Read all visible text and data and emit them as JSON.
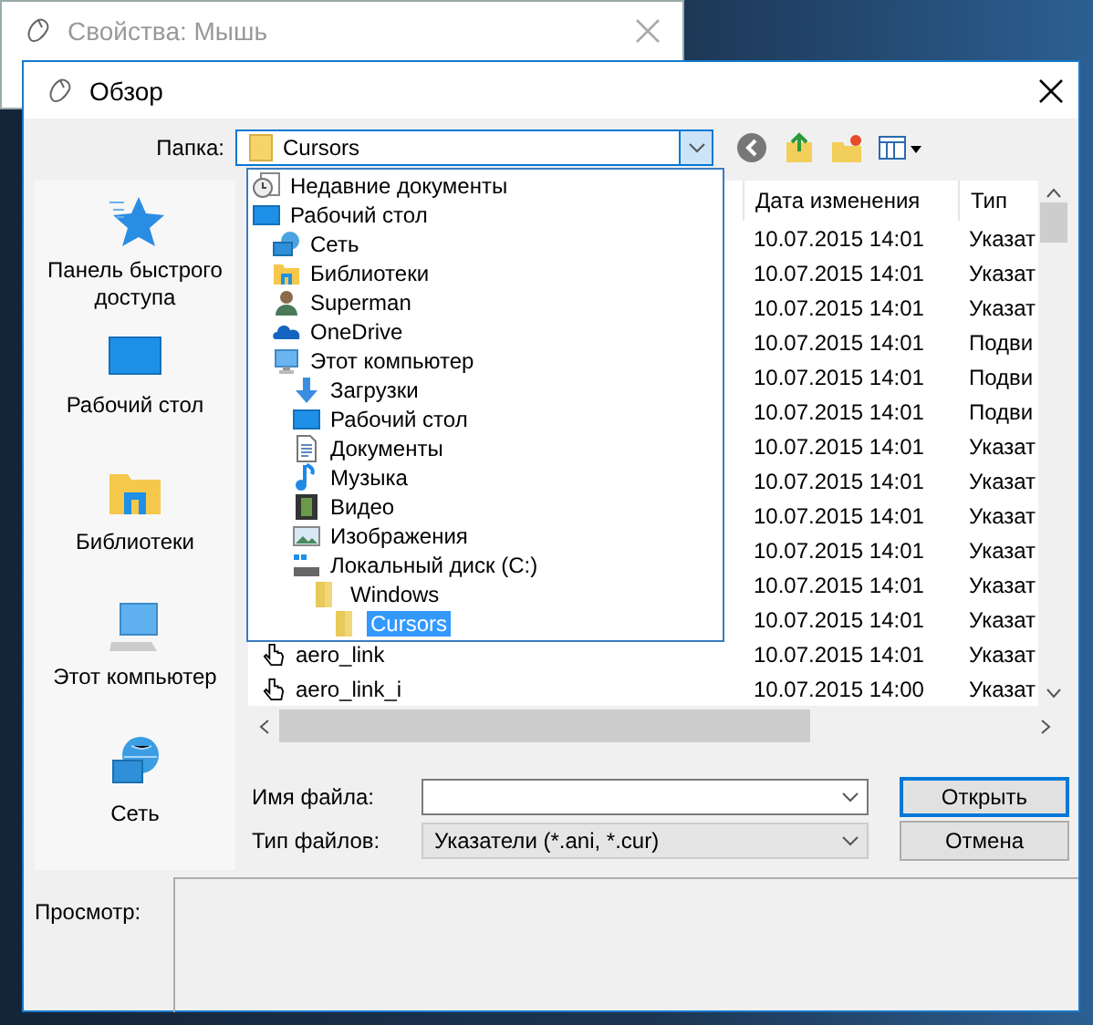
{
  "back_window": {
    "title": "Свойства: Мышь"
  },
  "dialog": {
    "title": "Обзор"
  },
  "folder_bar": {
    "label": "Папка:",
    "value": "Cursors"
  },
  "folder_dropdown": {
    "expanded": true,
    "items": [
      {
        "kind": "recent",
        "label": "Недавние документы",
        "selected": false
      },
      {
        "kind": "desktop",
        "label": "Рабочий стол",
        "selected": false,
        "children": [
          {
            "kind": "network",
            "label": "Сеть",
            "selected": false
          },
          {
            "kind": "libraries",
            "label": "Библиотеки",
            "selected": false
          },
          {
            "kind": "user",
            "label": "Superman",
            "selected": false
          },
          {
            "kind": "onedrive",
            "label": "OneDrive",
            "selected": false
          },
          {
            "kind": "computer",
            "label": "Этот компьютер",
            "selected": false,
            "children": [
              {
                "kind": "downloads",
                "label": "Загрузки",
                "selected": false
              },
              {
                "kind": "desktop",
                "label": "Рабочий стол",
                "selected": false
              },
              {
                "kind": "documents",
                "label": "Документы",
                "selected": false
              },
              {
                "kind": "music",
                "label": "Музыка",
                "selected": false
              },
              {
                "kind": "video",
                "label": "Видео",
                "selected": false
              },
              {
                "kind": "pictures",
                "label": "Изображения",
                "selected": false
              },
              {
                "kind": "drive",
                "label": "Локальный диск (C:)",
                "selected": false,
                "children": [
                  {
                    "kind": "folder",
                    "label": "Windows",
                    "selected": false,
                    "children": [
                      {
                        "kind": "folder",
                        "label": "Cursors",
                        "selected": true
                      }
                    ]
                  }
                ]
              }
            ]
          }
        ]
      }
    ]
  },
  "places": [
    {
      "kind": "quick-access",
      "label": "Панель быстрого доступа"
    },
    {
      "kind": "desktop",
      "label": "Рабочий стол"
    },
    {
      "kind": "libraries",
      "label": "Библиотеки"
    },
    {
      "kind": "computer",
      "label": "Этот компьютер"
    },
    {
      "kind": "network",
      "label": "Сеть"
    }
  ],
  "file_list": {
    "columns": [
      "Дата изменения",
      "Тип"
    ],
    "rows": [
      {
        "date": "10.07.2015 14:01",
        "type": "Указат"
      },
      {
        "date": "10.07.2015 14:01",
        "type": "Указат"
      },
      {
        "date": "10.07.2015 14:01",
        "type": "Указат"
      },
      {
        "date": "10.07.2015 14:01",
        "type": "Подви"
      },
      {
        "date": "10.07.2015 14:01",
        "type": "Подви"
      },
      {
        "date": "10.07.2015 14:01",
        "type": "Подви"
      },
      {
        "date": "10.07.2015 14:01",
        "type": "Указат"
      },
      {
        "date": "10.07.2015 14:01",
        "type": "Указат"
      },
      {
        "date": "10.07.2015 14:01",
        "type": "Указат"
      },
      {
        "date": "10.07.2015 14:01",
        "type": "Указат"
      },
      {
        "date": "10.07.2015 14:01",
        "type": "Указат"
      },
      {
        "date": "10.07.2015 14:01",
        "type": "Указат"
      },
      {
        "name": "aero_link",
        "date": "10.07.2015 14:01",
        "type": "Указат"
      },
      {
        "name": "aero_link_i",
        "date": "10.07.2015 14:00",
        "type": "Указат"
      }
    ]
  },
  "file_name": {
    "label": "Имя файла:"
  },
  "file_type": {
    "label": "Тип файлов:",
    "value": "Указатели (*.ani, *.cur)"
  },
  "buttons": [
    {
      "label": "Открыть",
      "default": true
    },
    {
      "label": "Отмена",
      "default": false
    }
  ],
  "preview": {
    "label": "Просмотр:"
  }
}
